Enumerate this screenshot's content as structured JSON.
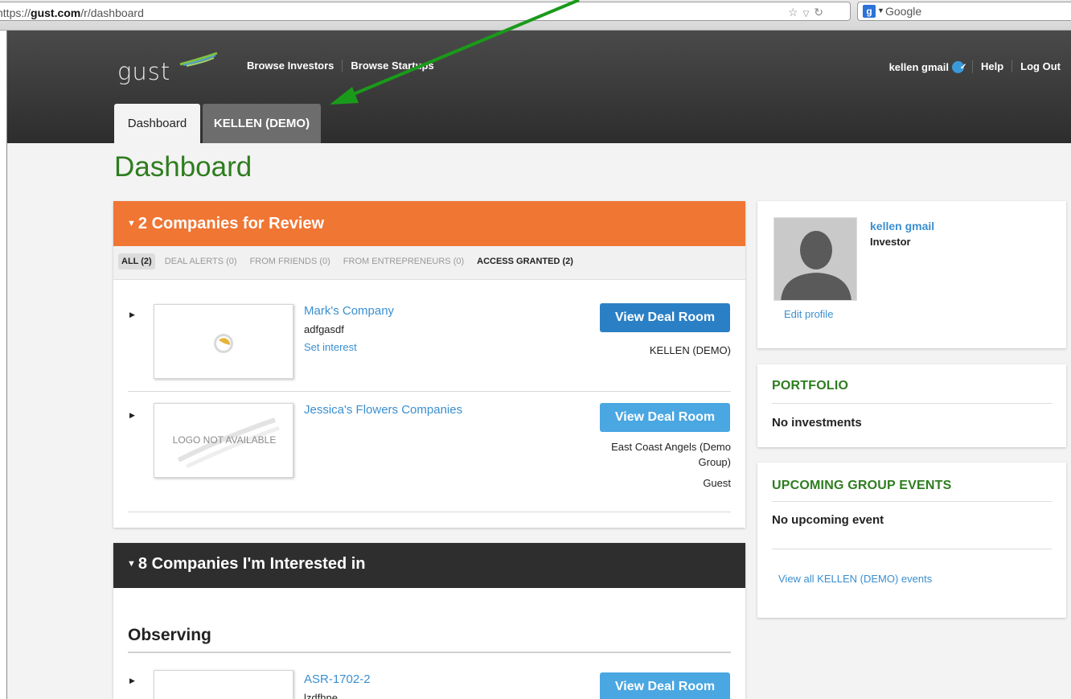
{
  "browser": {
    "url_prefix": "https://",
    "url_domain": "gust.com",
    "url_path": "/r/dashboard",
    "search_placeholder": "Google",
    "icons": [
      "star-icon",
      "dropdown-icon",
      "reload-icon"
    ]
  },
  "header": {
    "logo": "gust",
    "nav": [
      "Browse Investors",
      "Browse Startups"
    ],
    "user": "kellen gmail",
    "help": "Help",
    "logout": "Log Out",
    "tabs": {
      "active": "Dashboard",
      "other": "KELLEN (DEMO)"
    }
  },
  "page_title": "Dashboard",
  "review": {
    "title": "2 Companies for Review",
    "filters": [
      "ALL (2)",
      "DEAL ALERTS (0)",
      "FROM FRIENDS (0)",
      "FROM ENTREPRENEURS (0)",
      "ACCESS GRANTED (2)"
    ],
    "deals": [
      {
        "name": "Mark's Company",
        "sub": "adfgasdf",
        "link": "Set interest",
        "button": "View Deal Room",
        "group": "KELLEN (DEMO)"
      },
      {
        "name": "Jessica's Flowers Companies",
        "logo_text": "LOGO NOT AVAILABLE",
        "button": "View Deal Room",
        "group_line1": "East Coast Angels (Demo",
        "group_line2": "Group)",
        "role": "Guest"
      }
    ]
  },
  "interested": {
    "title": "8 Companies I'm Interested in",
    "section": "Observing",
    "deal": {
      "name": "ASR-1702-2",
      "sub": "lzdfhne",
      "button": "View Deal Room"
    }
  },
  "profile": {
    "name": "kellen gmail",
    "role": "Investor",
    "edit": "Edit profile"
  },
  "portfolio": {
    "title": "PORTFOLIO",
    "text": "No investments"
  },
  "events": {
    "title": "UPCOMING GROUP EVENTS",
    "text": "No upcoming event",
    "link": "View all KELLEN (DEMO) events"
  },
  "colors": {
    "orange": "#f07634",
    "green": "#2e7d1f",
    "blue": "#3a8fd0",
    "arrow": "#1a9a1a"
  }
}
